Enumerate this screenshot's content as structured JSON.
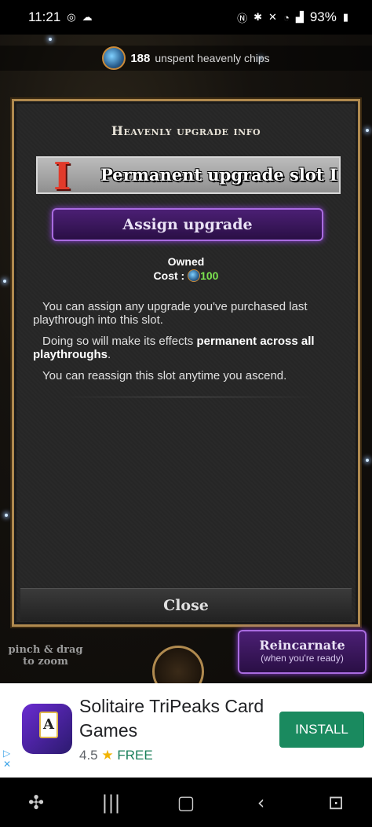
{
  "status_bar": {
    "time": "11:21",
    "battery": "93%"
  },
  "game": {
    "chips_count": "188",
    "chips_label": "unspent heavenly chips",
    "panel": {
      "title": "Heavenly upgrade info",
      "slot_numeral": "I",
      "slot_name": "Permanent upgrade slot I",
      "assign_label": "Assign upgrade",
      "owned_label": "Owned",
      "cost_label": "Cost :",
      "cost_amount": "100",
      "desc1": "You can assign any upgrade you've purchased last playthrough into this slot.",
      "desc2_pre": "Doing so will make its effects ",
      "desc2_bold": "permanent across all playthroughs",
      "desc2_post": ".",
      "desc3": "You can reassign this slot anytime you ascend.",
      "close_label": "Close"
    },
    "pinch_hint": "pinch & drag to zoom",
    "reincarnate_label": "Reincarnate",
    "reincarnate_sub": "(when you're ready)"
  },
  "ad": {
    "title": "Solitaire TriPeaks Card Games",
    "rating": "4.5",
    "price": "FREE",
    "install_label": "INSTALL",
    "icon_card_letter": "A"
  },
  "icons": {
    "status": [
      "instagram-icon",
      "cloud-icon",
      "nfc-icon",
      "bluetooth-icon",
      "mute-icon",
      "wifi-icon",
      "signal-icon",
      "battery-icon"
    ],
    "nav": [
      "game-launcher-icon",
      "recents-icon",
      "home-icon",
      "back-icon",
      "assistant-icon"
    ]
  }
}
